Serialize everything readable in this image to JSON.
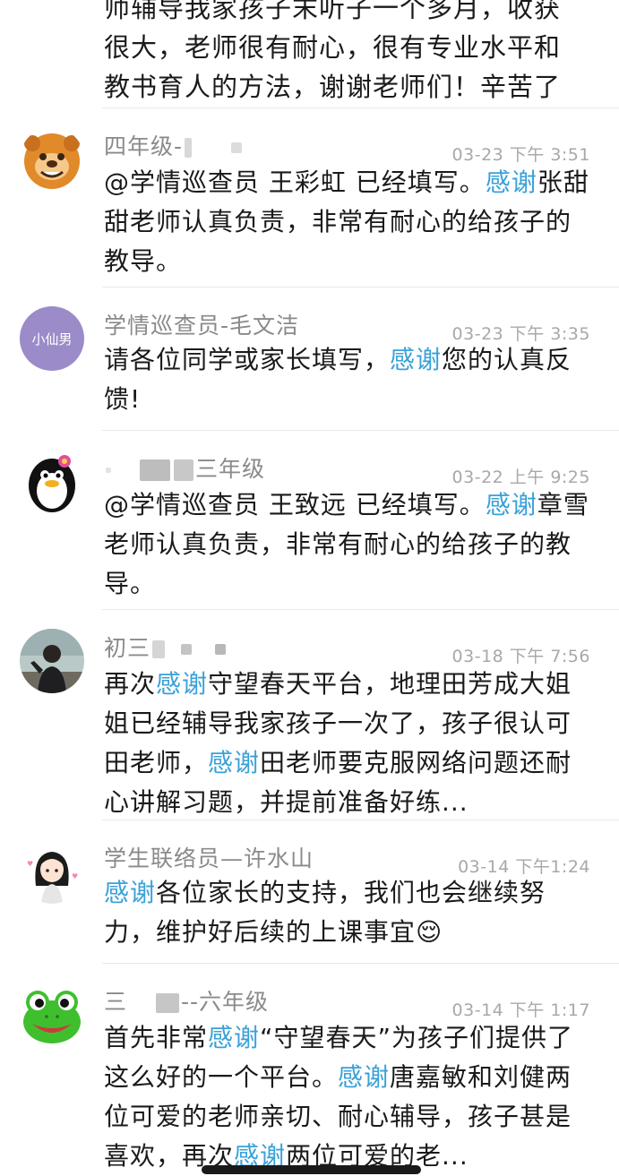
{
  "top_partial": {
    "line1": "师辅导我家孩子末听子一个多月，收获",
    "line2": "很大，老师很有耐心，很有专业水平和",
    "line3": "教书育人的方法，谢谢老师们！辛苦了"
  },
  "messages": [
    {
      "name": "四年级-",
      "time": "03-23 下午 3:51",
      "parts": [
        "@学情巡查员 王彩虹 已经填写。",
        "感谢",
        "张甜甜老师认真负责，非常有耐心的给孩子的教导。"
      ]
    },
    {
      "name": "学情巡查员-毛文洁",
      "avatar_text": "小仙男",
      "time": "03-23 下午 3:35",
      "parts": [
        "请各位同学或家长填写，",
        "感谢",
        "您的认真反馈!"
      ]
    },
    {
      "name": "三年级",
      "time": "03-22 上午 9:25",
      "parts": [
        "@学情巡查员 王致远 已经填写。",
        "感谢",
        "章雪老师认真负责，非常有耐心的给孩子的教导。"
      ]
    },
    {
      "name": "初三",
      "time": "03-18 下午 7:56",
      "parts": [
        "再次",
        "感谢",
        "守望春天平台，地理田芳成大姐姐已经辅导我家孩子一次了，孩子很认可田老师，",
        "感谢",
        "田老师要克服网络问题还耐心讲解习题，并提前准备好练..."
      ]
    },
    {
      "name": "学生联络员—许水山",
      "time": "03-14 下午1:24",
      "parts": [
        "感谢",
        "各位家长的支持，我们也会继续努力，维护好后续的上课事宜😌"
      ]
    },
    {
      "name": "三",
      "name_suffix": "--六年级",
      "time": "03-14 下午 1:17",
      "parts": [
        "首先非常",
        "感谢",
        "“守望春天”为孩子们提供了这么好的一个平台。",
        "感谢",
        "唐嘉敏和刘健两位可爱的老师亲切、耐心辅导，孩子甚是喜欢，再次",
        "感谢",
        "两位可爱的老..."
      ]
    }
  ],
  "colors": {
    "highlight": "#3aa1d8",
    "name": "#8a8a8a",
    "time": "#a8a8a8",
    "text": "#1a1a1a"
  }
}
